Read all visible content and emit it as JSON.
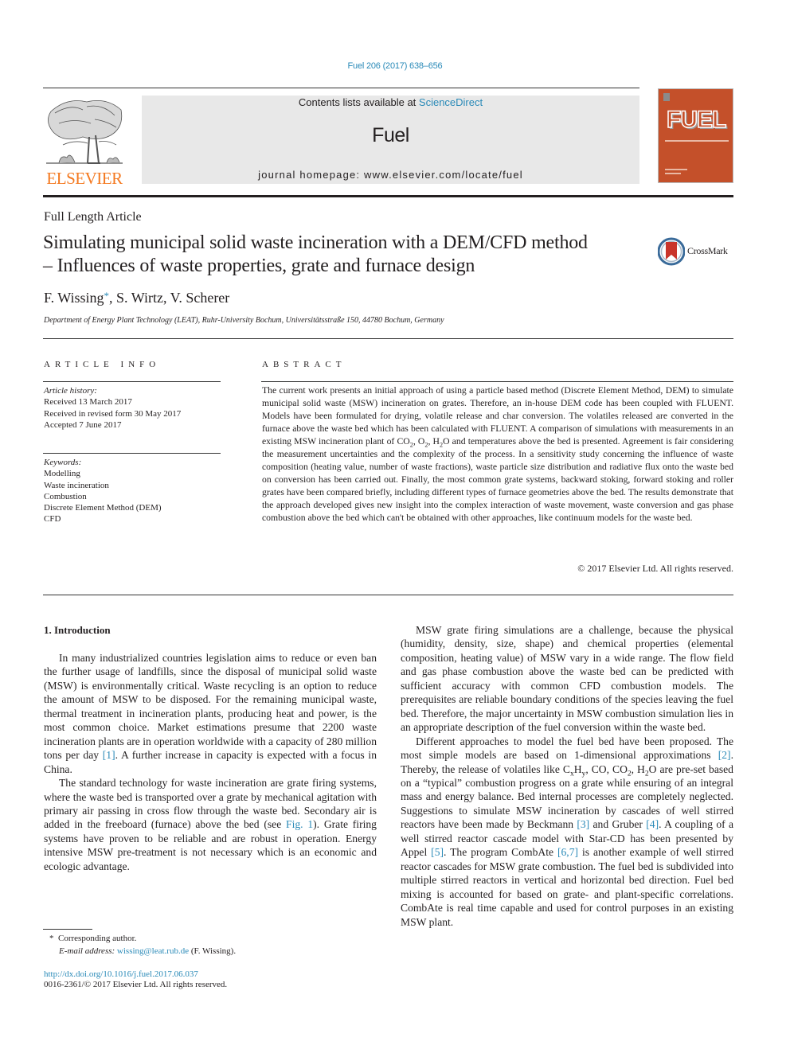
{
  "header": {
    "citation": "Fuel 206 (2017) 638–656",
    "contents_prefix": "Contents lists available at ",
    "contents_link": "ScienceDirect",
    "journal_name": "Fuel",
    "homepage": "journal homepage: www.elsevier.com/locate/fuel",
    "publisher_wordmark": "ELSEVIER",
    "cover_title": "FUEL",
    "colors": {
      "link": "#2a8ab8",
      "elsevier_orange": "#f47920",
      "cover": "#c4502a",
      "banner": "#e8e8e8"
    }
  },
  "article": {
    "type": "Full Length Article",
    "title_line1": "Simulating municipal solid waste incineration with a DEM/CFD method",
    "title_line2": "– Influences of waste properties, grate and furnace design",
    "crossmark_label": "CrossMark",
    "authors": {
      "first": "F. Wissing",
      "first_mark": "*",
      "rest": ", S. Wirtz, V. Scherer"
    },
    "affiliation": "Department of Energy Plant Technology (LEAT), Ruhr-University Bochum, Universitätsstraße 150, 44780 Bochum, Germany"
  },
  "article_info": {
    "heading": "ARTICLE INFO",
    "history_label": "Article history:",
    "history": [
      "Received 13 March 2017",
      "Received in revised form 30 May 2017",
      "Accepted 7 June 2017"
    ],
    "keywords_label": "Keywords:",
    "keywords": [
      "Modelling",
      "Waste incineration",
      "Combustion",
      "Discrete Element Method (DEM)",
      "CFD"
    ]
  },
  "abstract": {
    "heading": "ABSTRACT",
    "part1": "The current work presents an initial approach of using a particle based method (Discrete Element Method, DEM) to simulate municipal solid waste (MSW) incineration on grates. Therefore, an in-house DEM code has been coupled with FLUENT. Models have been formulated for drying, volatile release and char conversion. The volatiles released are converted in the furnace above the waste bed which has been calculated with FLUENT. A comparison of simulations with measurements in an existing MSW incineration plant of CO",
    "sub1": "2",
    "part2": ", O",
    "sub2": "2",
    "part3": ", H",
    "sub3": "2",
    "part4": "O and temperatures above the bed is presented. Agreement is fair considering the measurement uncertainties and the complexity of the process. In a sensitivity study concerning the influence of waste composition (heating value, number of waste fractions), waste particle size distribution and radiative flux onto the waste bed on conversion has been carried out. Finally, the most common grate systems, backward stoking, forward stoking and roller grates have been compared briefly, including different types of furnace geometries above the bed. The results demonstrate that the approach developed gives new insight into the complex interaction of waste movement, waste conversion and gas phase combustion above the bed which can't be obtained with other approaches, like continuum models for the waste bed.",
    "copyright": "© 2017 Elsevier Ltd. All rights reserved."
  },
  "body": {
    "section_title": "1. Introduction",
    "left_p1_a": "In many industrialized countries legislation aims to reduce or even ban the further usage of landfills, since the disposal of municipal solid waste (MSW) is environmentally critical. Waste recycling is an option to reduce the amount of MSW to be disposed. For the remaining municipal waste, thermal treatment in incineration plants, producing heat and power, is the most common choice. Market estimations presume that 2200 waste incineration plants are in operation worldwide with a capacity of 280 million tons per day ",
    "left_p1_ref": "[1]",
    "left_p1_b": ". A further increase in capacity is expected with a focus in China.",
    "left_p2_a": "The standard technology for waste incineration are grate firing systems, where the waste bed is transported over a grate by mechanical agitation with primary air passing in cross flow through the waste bed. Secondary air is added in the freeboard (furnace) above the bed (see ",
    "left_p2_ref": "Fig. 1",
    "left_p2_b": "). Grate firing systems have proven to be reliable and are robust in operation. Energy intensive MSW pre-treatment is not necessary which is an economic and ecologic advantage.",
    "right_p1": "MSW grate firing simulations are a challenge, because the physical (humidity, density, size, shape) and chemical properties (elemental composition, heating value) of MSW vary in a wide range. The flow field and gas phase combustion above the waste bed can be predicted with sufficient accuracy with common CFD combustion models. The prerequisites are reliable boundary conditions of the species leaving the fuel bed. Therefore, the major uncertainty in MSW combustion simulation lies in an appropriate description of the fuel conversion within the waste bed.",
    "right_p2_a": "Different approaches to model the fuel bed have been proposed. The most simple models are based on 1-dimensional approximations ",
    "right_p2_ref2": "[2]",
    "right_p2_b": ". Thereby, the release of volatiles like C",
    "right_p2_subx": "x",
    "right_p2_c": "H",
    "right_p2_suby": "y",
    "right_p2_d": ", CO, CO",
    "right_p2_sub2a": "2",
    "right_p2_e": ", H",
    "right_p2_sub2b": "2",
    "right_p2_f": "O are pre-set based on a “typical” combustion progress on a grate while ensuring of an integral mass and energy balance. Bed internal processes are completely neglected. Suggestions to simulate MSW incineration by cascades of well stirred reactors have been made by Beckmann ",
    "right_p2_ref3": "[3]",
    "right_p2_g": " and Gruber ",
    "right_p2_ref4": "[4]",
    "right_p2_h": ". A coupling of a well stirred reactor cascade model with Star-CD has been presented by Appel ",
    "right_p2_ref5": "[5]",
    "right_p2_i": ". The program CombAte ",
    "right_p2_ref67": "[6,7]",
    "right_p2_j": " is another example of well stirred reactor cascades for MSW grate combustion. The fuel bed is subdivided into multiple stirred reactors in vertical and horizontal bed direction. Fuel bed mixing is accounted for based on grate- and plant-specific correlations. CombAte is real time capable and used for control purposes in an existing MSW plant."
  },
  "footnotes": {
    "star": "*",
    "corresponding": "Corresponding author.",
    "email_label": "E-mail address:",
    "email": "wissing@leat.rub.de",
    "email_suffix": " (F. Wissing).",
    "doi": "http://dx.doi.org/10.1016/j.fuel.2017.06.037",
    "issn": "0016-2361/© 2017 Elsevier Ltd. All rights reserved."
  }
}
